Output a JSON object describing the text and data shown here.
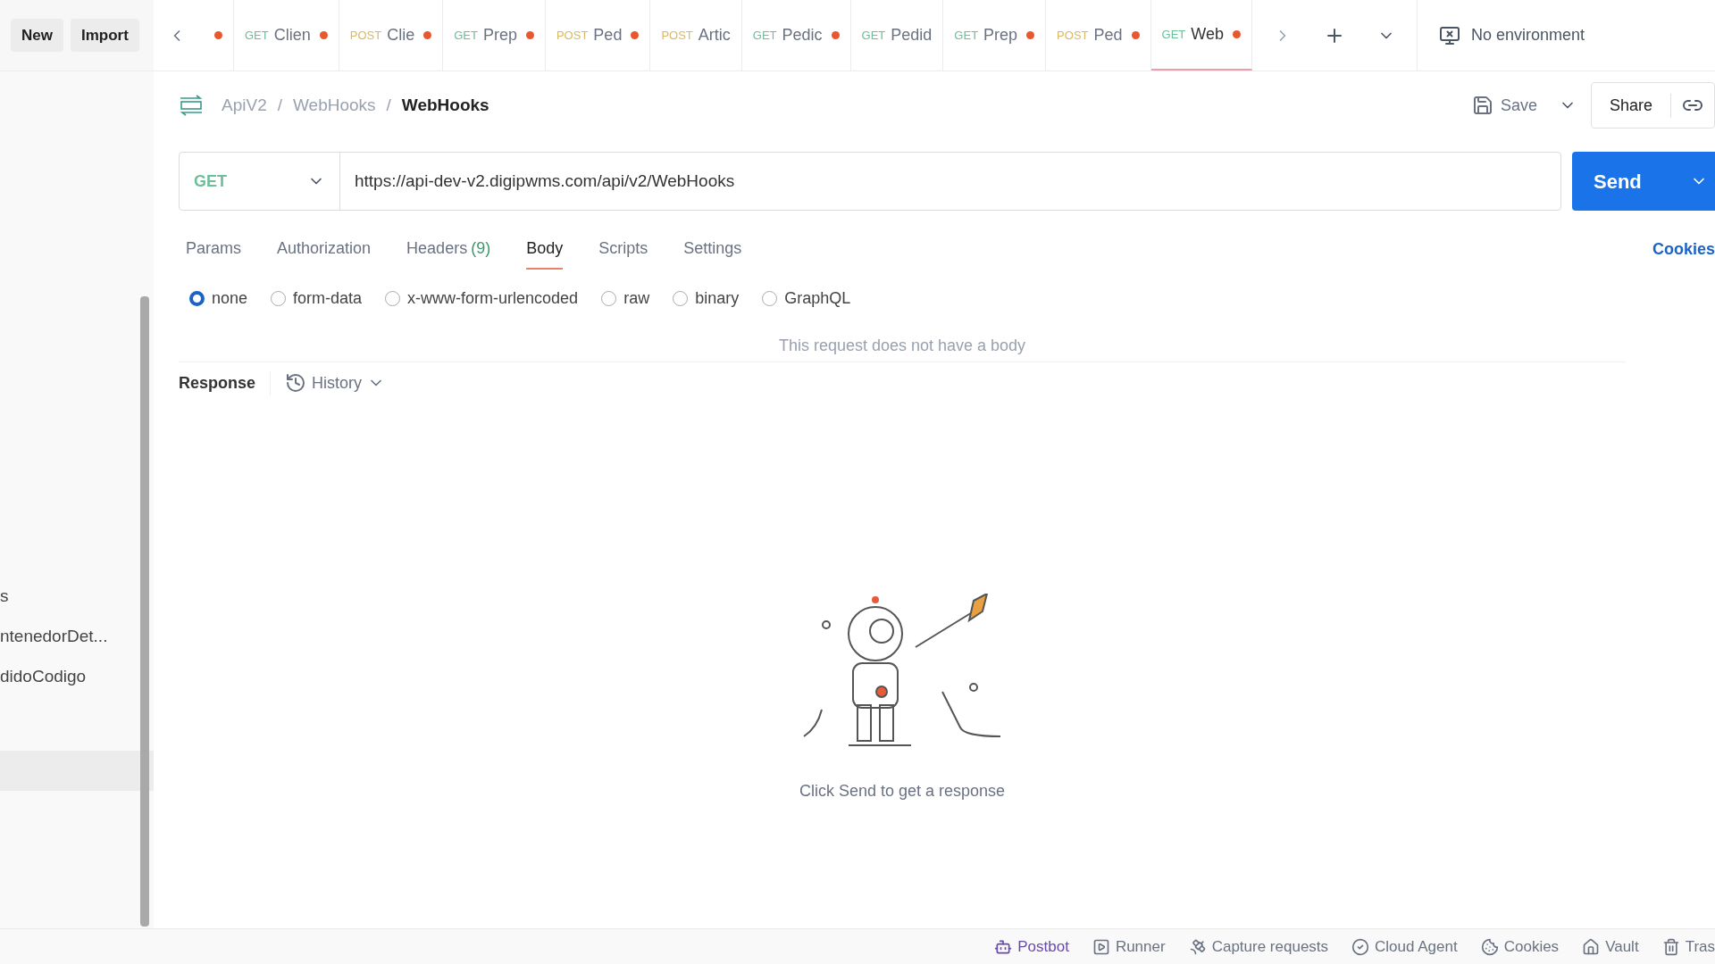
{
  "header": {
    "buttons": [
      "New",
      "Import"
    ],
    "environment": "No environment"
  },
  "tabs": [
    {
      "unsaved": true,
      "selected": false
    },
    {
      "method": "GET",
      "name": "Clien",
      "unsaved": true,
      "selected": false
    },
    {
      "method": "POST",
      "name": "Clie",
      "unsaved": true,
      "selected": false
    },
    {
      "method": "GET",
      "name": "Prep",
      "unsaved": true,
      "selected": false
    },
    {
      "method": "POST",
      "name": "Ped",
      "unsaved": true,
      "selected": false
    },
    {
      "method": "POST",
      "name": "Artic",
      "unsaved": false,
      "selected": false
    },
    {
      "method": "GET",
      "name": "Pedic",
      "unsaved": true,
      "selected": false
    },
    {
      "method": "GET",
      "name": "Pedid",
      "unsaved": false,
      "selected": false
    },
    {
      "method": "GET",
      "name": "Prep",
      "unsaved": true,
      "selected": false
    },
    {
      "method": "POST",
      "name": "Ped",
      "unsaved": true,
      "selected": false
    },
    {
      "method": "GET",
      "name": "Web",
      "unsaved": true,
      "selected": true
    }
  ],
  "sidebar": {
    "items": [
      {
        "label": "s",
        "selected": false
      },
      {
        "label": "ntenedorDet...",
        "selected": false
      },
      {
        "label": "didoCodigo",
        "selected": false
      },
      {
        "selected": true
      }
    ]
  },
  "breadcrumb": [
    "ApiV2",
    "WebHooks",
    "WebHooks"
  ],
  "breadcrumb_separators": [
    "/",
    "/"
  ],
  "actions": {
    "save": "Save",
    "share": "Share"
  },
  "request": {
    "method": "GET",
    "url": "https://api-dev-v2.digipwms.com/api/v2/WebHooks",
    "send": "Send"
  },
  "request_tabs": [
    {
      "label": "Params",
      "selected": false
    },
    {
      "label": "Authorization",
      "selected": false
    },
    {
      "label": "Headers",
      "count": "(9)",
      "selected": false
    },
    {
      "label": "Body",
      "selected": true
    },
    {
      "label": "Scripts",
      "selected": false
    },
    {
      "label": "Settings",
      "selected": false
    }
  ],
  "cookies_link": "Cookies",
  "body_types": [
    {
      "label": "none",
      "selected": true
    },
    {
      "label": "form-data",
      "selected": false
    },
    {
      "label": "x-www-form-urlencoded",
      "selected": false
    },
    {
      "label": "raw",
      "selected": false
    },
    {
      "label": "binary",
      "selected": false
    },
    {
      "label": "GraphQL",
      "selected": false
    }
  ],
  "body_empty": "This request does not have a body",
  "response": {
    "title": "Response",
    "history": "History",
    "hint": "Click Send to get a response"
  },
  "status_bar": [
    "Postbot",
    "Runner",
    "Capture requests",
    "Cloud Agent",
    "Cookies",
    "Vault",
    "Tras"
  ]
}
